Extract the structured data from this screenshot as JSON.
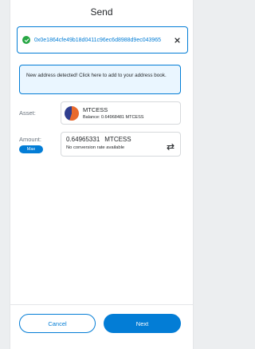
{
  "header": {
    "title": "Send"
  },
  "recipient": {
    "address": "0x0e1864cfe49b18d0411c96ec6d8988d9ec043965",
    "status_icon": "check-circle-icon",
    "clear_icon": "close-icon"
  },
  "notice": {
    "text": "New address detected! Click here to add to your address book."
  },
  "asset": {
    "label": "Asset:",
    "name": "MTCESS",
    "balance": "Balance: 0.64968481 MTCESS"
  },
  "amount": {
    "label": "Amount:",
    "max_label": "Max",
    "value": "0.64965331",
    "unit": "MTCESS",
    "conversion": "No conversion rate available",
    "swap_icon": "swap-icon"
  },
  "footer": {
    "cancel_label": "Cancel",
    "next_label": "Next"
  },
  "colors": {
    "accent": "#037dd6",
    "success": "#28a745",
    "notice_bg": "#eaf6ff"
  }
}
